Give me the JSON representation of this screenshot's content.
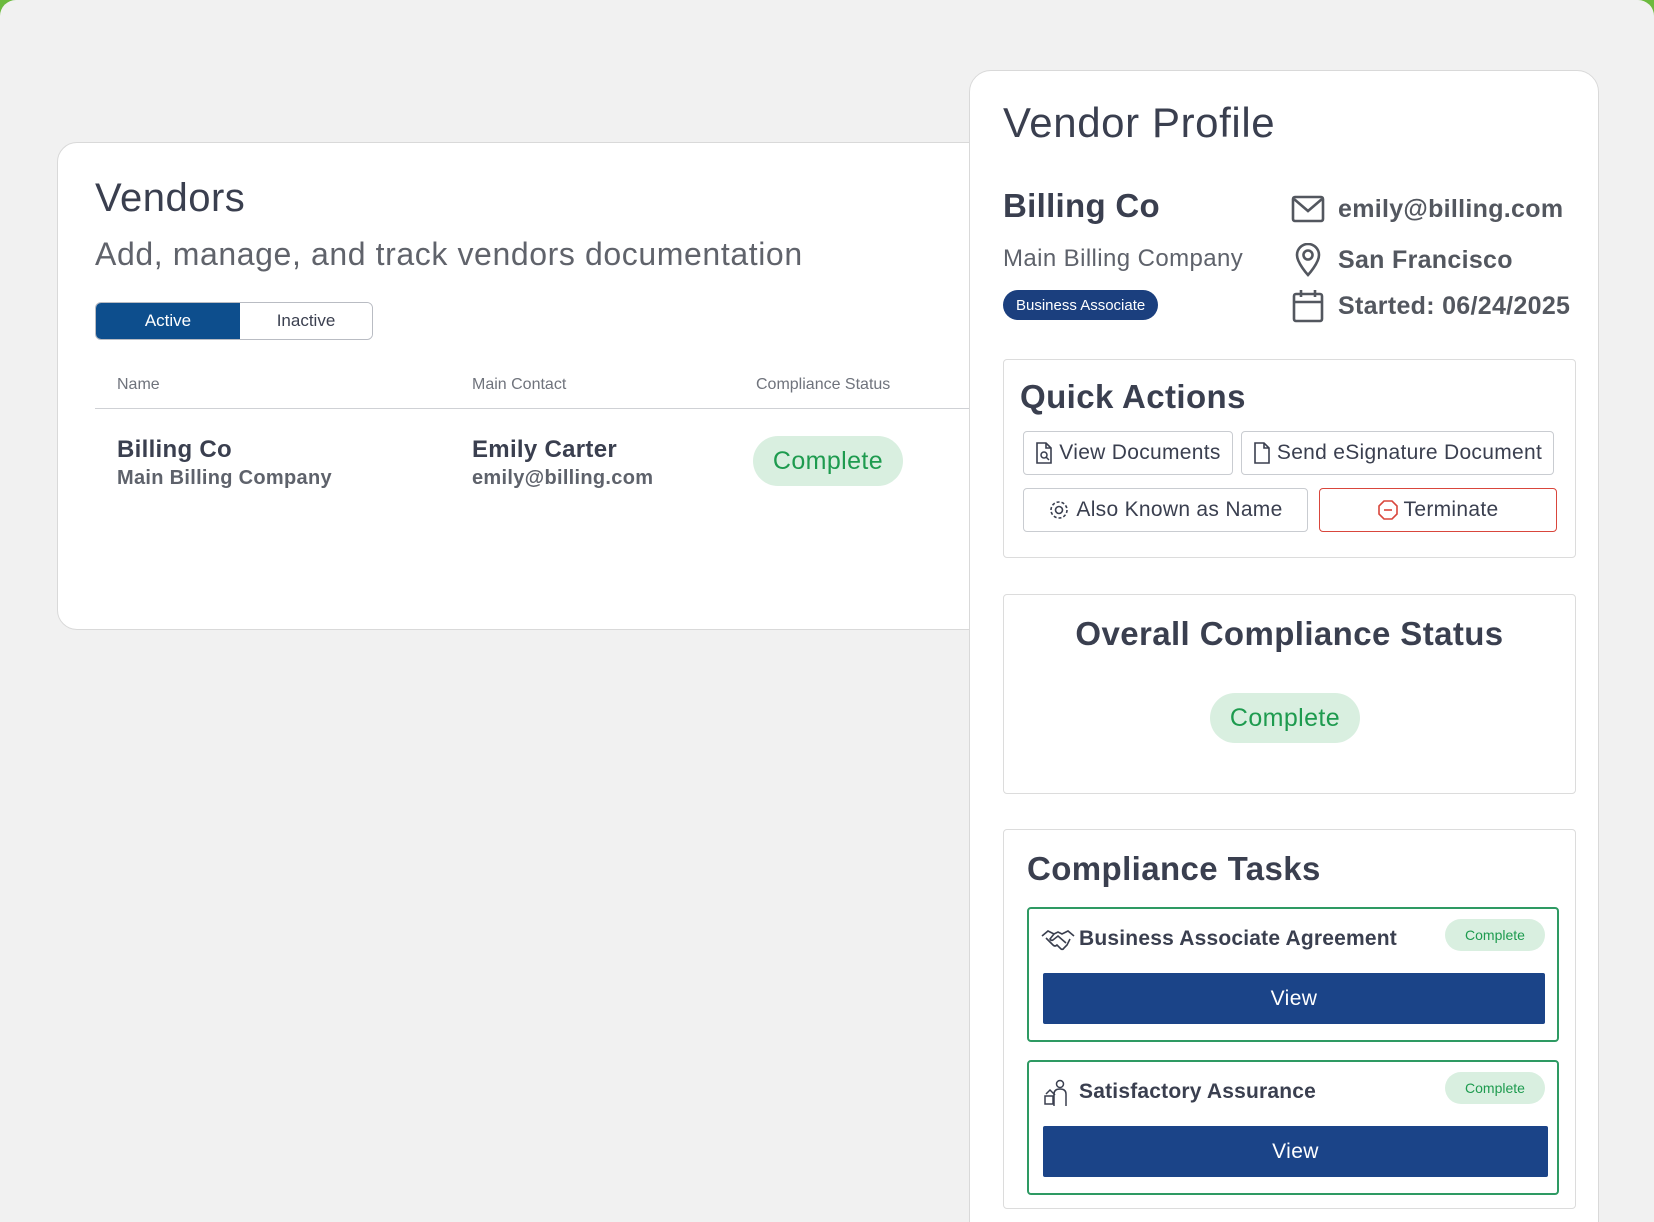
{
  "vendors": {
    "title": "Vendors",
    "subtitle": "Add, manage, and track vendors documentation",
    "tabs": {
      "active": "Active",
      "inactive": "Inactive"
    },
    "columns": {
      "name": "Name",
      "contact": "Main Contact",
      "status": "Compliance Status"
    },
    "rows": [
      {
        "name": "Billing Co",
        "company": "Main Billing Company",
        "contact_name": "Emily Carter",
        "contact_email": "emily@billing.com",
        "status": "Complete"
      }
    ]
  },
  "profile": {
    "title": "Vendor Profile",
    "name": "Billing Co",
    "company": "Main Billing Company",
    "badge": "Business Associate",
    "email": "emily@billing.com",
    "location": "San Francisco",
    "started": "Started: 06/24/2025",
    "quick_actions": {
      "title": "Quick Actions",
      "view_documents": "View Documents",
      "send_esignature": "Send eSignature Document",
      "aka_name": "Also Known as Name",
      "terminate": "Terminate"
    },
    "overall": {
      "title": "Overall Compliance Status",
      "status": "Complete"
    },
    "tasks": {
      "title": "Compliance Tasks",
      "items": [
        {
          "name": "Business Associate Agreement",
          "status": "Complete",
          "action": "View",
          "icon": "handshake-icon"
        },
        {
          "name": "Satisfactory Assurance",
          "status": "Complete",
          "action": "View",
          "icon": "assurance-icon"
        }
      ]
    }
  },
  "colors": {
    "primary": "#0d4e8d",
    "badge_navy": "#1b3f7e",
    "view_button": "#1b4488",
    "complete_text": "#1e9b4f",
    "complete_bg": "#d9efe0",
    "danger": "#d9463c",
    "task_border": "#2e9a63",
    "frame": "#6cba3e"
  }
}
